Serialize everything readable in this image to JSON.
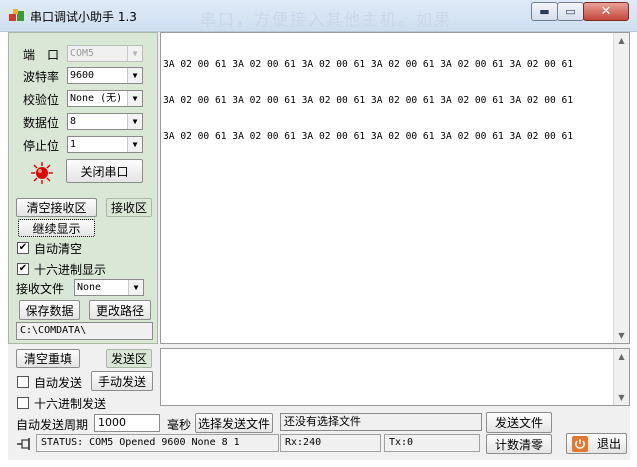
{
  "window": {
    "title": "串口调试小助手 1.3",
    "watermark": "串口，方便接入其他主机。如果",
    "minimize_glyph": "▬",
    "maximize_glyph": "▭",
    "close_glyph": "✕"
  },
  "settings": {
    "port_label": "端　口",
    "port_value": "COM5",
    "baud_label": "波特率",
    "baud_value": "9600",
    "parity_label": "校验位",
    "parity_value": "None (无)",
    "databits_label": "数据位",
    "databits_value": "8",
    "stopbits_label": "停止位",
    "stopbits_value": "1",
    "port_indicator_color": "#e00000",
    "close_port_label": "关闭串口"
  },
  "receive": {
    "clear_label": "清空接收区",
    "area_label": "接收区",
    "continue_label": "继续显示",
    "auto_clear_label": "自动清空",
    "auto_clear_checked": true,
    "hex_display_label": "十六进制显示",
    "hex_display_checked": true,
    "file_label": "接收文件",
    "file_value": "None",
    "save_data_label": "保存数据",
    "change_path_label": "更改路径",
    "path_value": "C:\\COMDATA\\",
    "lines": [
      "3A 02 00 61 3A 02 00 61 3A 02 00 61 3A 02 00 61 3A 02 00 61 3A 02 00 61",
      "3A 02 00 61 3A 02 00 61 3A 02 00 61 3A 02 00 61 3A 02 00 61 3A 02 00 61",
      "3A 02 00 61 3A 02 00 61 3A 02 00 61 3A 02 00 61 3A 02 00 61 3A 02 00 61"
    ]
  },
  "send": {
    "clear_refill_label": "清空重填",
    "area_label": "发送区",
    "auto_send_label": "自动发送",
    "auto_send_checked": false,
    "manual_send_label": "手动发送",
    "hex_send_label": "十六进制发送",
    "hex_send_checked": false,
    "period_label": "自动发送周期",
    "period_value": "1000",
    "ms_label": "毫秒",
    "select_file_label": "选择发送文件",
    "file_status": "还没有选择文件",
    "send_file_label": "发送文件"
  },
  "status": {
    "text": "STATUS: COM5 Opened 9600 None  8 1",
    "rx": "Rx:240",
    "tx": "Tx:0",
    "reset_count_label": "计数清零",
    "exit_label": "退出"
  }
}
